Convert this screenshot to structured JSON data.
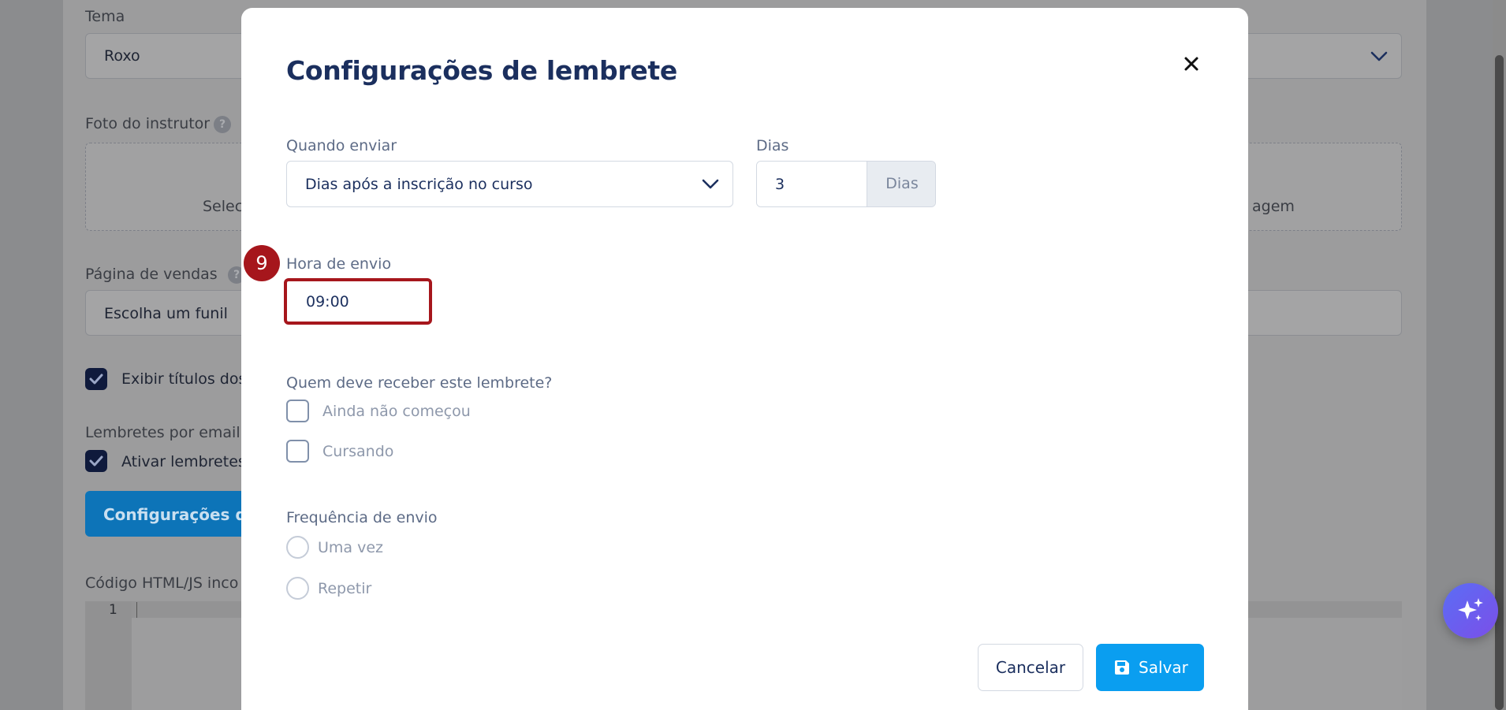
{
  "background": {
    "theme_label": "Tema",
    "theme_value": "Roxo",
    "instructor_photo_label": "Foto do instrutor",
    "upload_left_text": "Selec",
    "upload_right_text": "agem",
    "sales_page_label": "Página de vendas",
    "sales_page_value": "Escolha um funil",
    "show_titles_label": "Exibir títulos dos",
    "email_reminders_label": "Lembretes por email",
    "enable_reminders_label": "Ativar lembretes",
    "config_button_label": "Configurações de",
    "code_label": "Código HTML/JS inco",
    "editor_line_number": "1",
    "help_glyph": "?"
  },
  "modal": {
    "title": "Configurações de lembrete",
    "close_glyph": "×",
    "when_send": {
      "label": "Quando enviar",
      "value": "Dias após a inscrição no curso"
    },
    "days": {
      "label": "Dias",
      "value": "3",
      "addon": "Dias"
    },
    "send_time": {
      "label": "Hora de envio",
      "value": "09:00",
      "step_number": "9"
    },
    "recipients": {
      "label": "Quem deve receber este lembrete?",
      "options": [
        {
          "label": "Ainda não começou",
          "checked": false
        },
        {
          "label": "Cursando",
          "checked": false
        }
      ]
    },
    "frequency": {
      "label": "Frequência de envio",
      "options": [
        {
          "label": "Uma vez",
          "selected": false
        },
        {
          "label": "Repetir",
          "selected": false
        }
      ]
    },
    "cancel_label": "Cancelar",
    "save_label": "Salvar"
  },
  "colors": {
    "title": "#1b2f5e",
    "primary": "#0a9ef0",
    "step_highlight": "#a6161c",
    "overlay": "#8b8c8e"
  },
  "icons": {
    "close": "close-icon",
    "chevron": "chevron-down-icon",
    "save": "floppy-disk-icon",
    "ai": "sparkles-icon",
    "check": "checkmark-icon"
  }
}
